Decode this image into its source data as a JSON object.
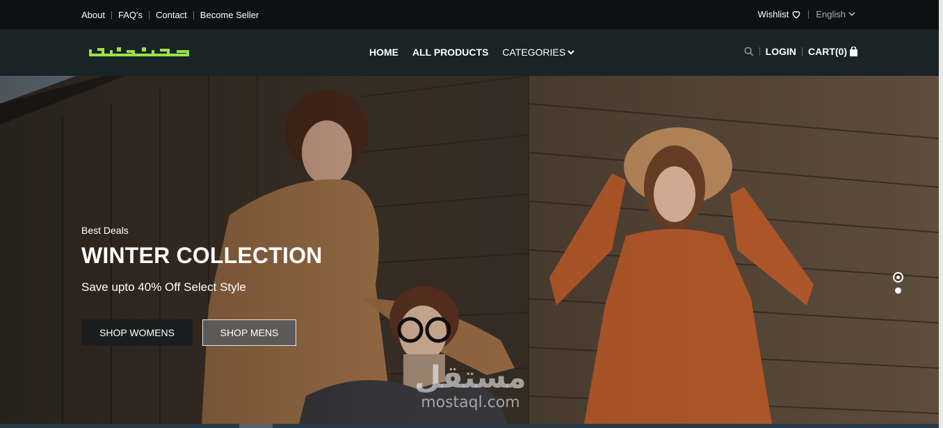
{
  "topbar": {
    "links": [
      "About",
      "FAQ's",
      "Contact",
      "Become Seller"
    ],
    "wishlist_label": "Wishlist",
    "wishlist_icon": "heart-icon",
    "language": "English",
    "language_icon": "chevron-down-icon"
  },
  "nav": {
    "logo_text": "تصفقت",
    "menu": {
      "home": "HOME",
      "all_products": "ALL PRODUCTS",
      "categories": "CATEGORIES"
    },
    "search_icon": "search-icon",
    "login": "LOGIN",
    "cart": "CART(0)",
    "cart_icon": "bag-icon"
  },
  "hero": {
    "eyebrow": "Best Deals",
    "headline": "WINTER COLLECTION",
    "subline": "Save upto 40% Off Select Style",
    "button_women": "SHOP WOMENS",
    "button_men": "SHOP MENS",
    "slides_total": 2,
    "active_slide": 1
  },
  "watermark": {
    "arabic": "مستقل",
    "latin": "mostaql.com"
  },
  "colors": {
    "topbar_bg": "#0d1112",
    "nav_bg": "#1a2326",
    "logo_accent": "#9be04a",
    "button_dark": "#1b1d1e",
    "button_grey": "#5c5a58"
  }
}
